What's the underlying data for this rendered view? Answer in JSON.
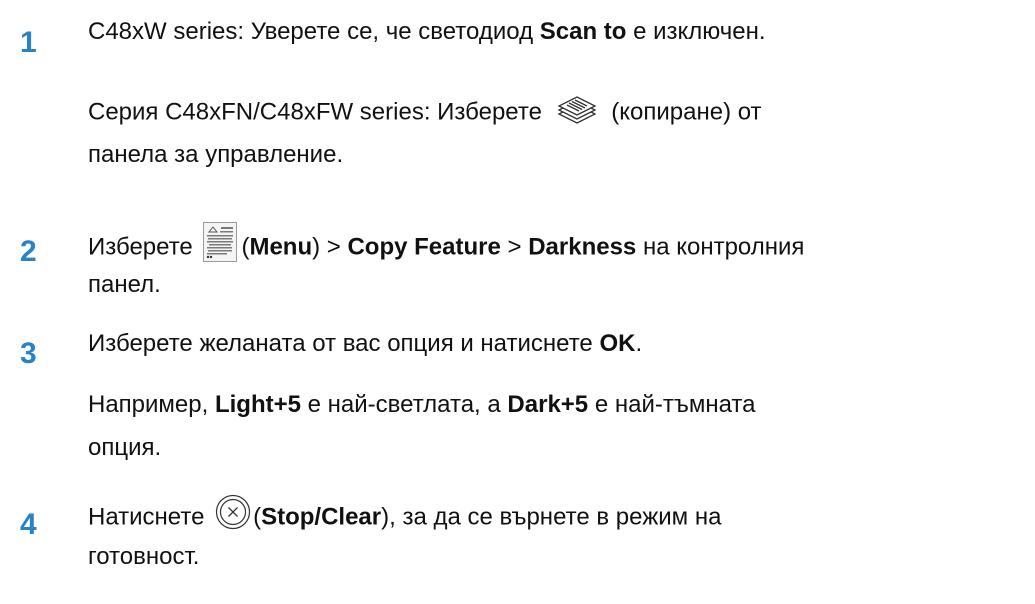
{
  "steps": [
    {
      "number": "1",
      "line1_prefix": "C48xW series: Уверете се, че светодиод ",
      "line1_bold": "Scan to",
      "line1_suffix": " е изключен.",
      "line2_prefix": "Серия C48xFN/C48xFW series: Изберете ",
      "line2_icon": "copy-icon",
      "line2_suffix": " (копиране) от",
      "line3": "панела за управление."
    },
    {
      "number": "2",
      "line1_prefix": "Изберете ",
      "line1_icon": "menu-icon",
      "line1_paren_open": "(",
      "line1_bold_menu": "Menu",
      "line1_paren_close": ") > ",
      "line1_bold_copy": "Copy Feature",
      "line1_sep": " > ",
      "line1_bold_darkness": "Darkness",
      "line1_suffix": " на контролния",
      "line2": "панел."
    },
    {
      "number": "3",
      "line1_prefix": "Изберете желаната от вас опция и натиснете ",
      "line1_bold": "OK",
      "line1_suffix": ".",
      "line2_prefix": "Например, ",
      "line2_bold_light": "Light+5",
      "line2_mid": " е най-светлата, а ",
      "line2_bold_dark": "Dark+5",
      "line2_suffix": " е най-тъмната",
      "line3": "опция."
    },
    {
      "number": "4",
      "line1_prefix": "Натиснете ",
      "line1_icon": "stop-clear-icon",
      "line1_paren_open": "(",
      "line1_bold": "Stop/Clear",
      "line1_suffix": "), за да се върнете в режим на",
      "line2": "готовност."
    }
  ],
  "colors": {
    "step_number": "#2a82c6",
    "text": "#111111"
  }
}
